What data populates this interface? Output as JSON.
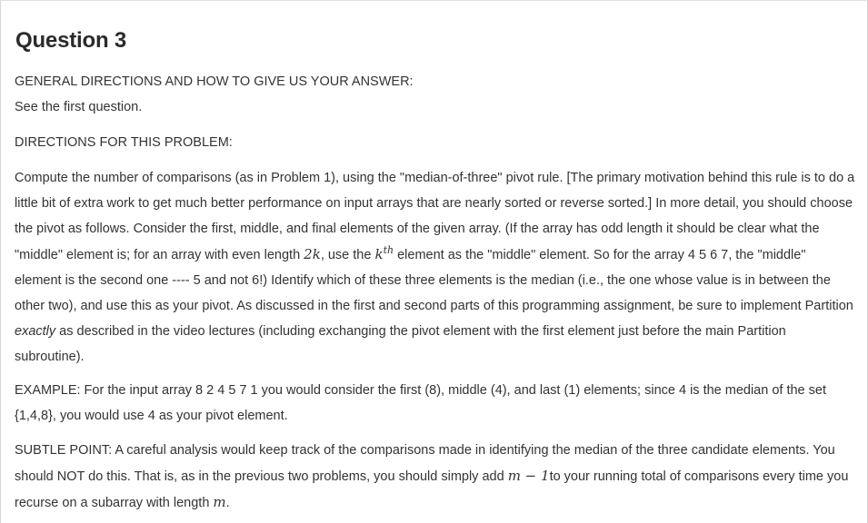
{
  "title": "Question 3",
  "general_heading": "GENERAL DIRECTIONS AND HOW TO GIVE US YOUR ANSWER:",
  "general_text": "See the first question.",
  "directions_heading": "DIRECTIONS FOR THIS PROBLEM:",
  "main": {
    "p1": "Compute the number of comparisons (as in Problem 1), using the \"median-of-three\" pivot rule. [The primary motivation behind this rule is to do a little bit of extra work to get much better performance on input arrays that are nearly sorted or reverse sorted.] In more detail, you should choose the pivot as follows. Consider the first, middle, and final elements of the given array. (If the array has odd length it should be clear what the \"middle\" element is; for an array with even length ",
    "math_2k": "2k",
    "p2": ", use the ",
    "math_k": "k",
    "math_th": "th",
    "p3": " element as the \"middle\" element. So for the array 4 5 6 7, the \"middle\" element is the second one ---- 5 and not 6!) Identify which of these three elements is the median (i.e., the one whose value is in between the other two), and use this as your pivot. As discussed in the first and second parts of this programming assignment, be sure to implement Partition ",
    "emph": "exactly",
    "p4": " as described in the video lectures (including exchanging the pivot element with the first element just before the main Partition subroutine)."
  },
  "example": "EXAMPLE: For the input array 8 2 4 5 7 1 you would consider the first (8), middle (4), and last (1) elements; since 4 is the median of the set {1,4,8}, you would use 4 as your pivot element.",
  "subtle": {
    "p1": "SUBTLE POINT: A careful analysis would keep track of the comparisons made in identifying the median of the three candidate elements. You should NOT do this. That is, as in the previous two problems, you should simply add ",
    "math_expr": "m − 1",
    "p2": "to your running total of comparisons every time you recurse on a subarray with length ",
    "math_m": "m",
    "p3": "."
  }
}
